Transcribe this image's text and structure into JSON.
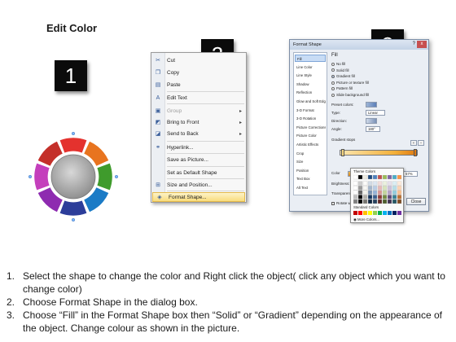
{
  "title": "Edit Color",
  "badges": [
    "1",
    "2",
    "3"
  ],
  "wheel": {
    "colors": [
      "#e4322e",
      "#e8741f",
      "#3f9b2c",
      "#1b7bc6",
      "#2c3d9a",
      "#8e2bb0",
      "#c43fbc",
      "#c4302a"
    ]
  },
  "context_menu": {
    "items": [
      {
        "label": "Cut",
        "icon": "cut-icon",
        "glyph": "✂",
        "disabled": false,
        "submenu": false,
        "highlighted": false
      },
      {
        "label": "Copy",
        "icon": "copy-icon",
        "glyph": "❐",
        "disabled": false,
        "submenu": false,
        "highlighted": false
      },
      {
        "label": "Paste",
        "icon": "paste-icon",
        "glyph": "▤",
        "disabled": false,
        "submenu": false,
        "highlighted": false
      },
      {
        "label": "Edit Text",
        "icon": "edit-text-icon",
        "glyph": "A",
        "disabled": false,
        "submenu": false,
        "highlighted": false
      },
      {
        "label": "Group",
        "icon": "group-icon",
        "glyph": "▣",
        "disabled": true,
        "submenu": true,
        "highlighted": false
      },
      {
        "label": "Bring to Front",
        "icon": "bring-to-front-icon",
        "glyph": "◩",
        "disabled": false,
        "submenu": true,
        "highlighted": false
      },
      {
        "label": "Send to Back",
        "icon": "send-to-back-icon",
        "glyph": "◪",
        "disabled": false,
        "submenu": true,
        "highlighted": false
      },
      {
        "label": "Hyperlink...",
        "icon": "hyperlink-icon",
        "glyph": "⚭",
        "disabled": false,
        "submenu": false,
        "highlighted": false
      },
      {
        "label": "Save as Picture...",
        "icon": "",
        "glyph": "",
        "disabled": false,
        "submenu": false,
        "highlighted": false
      },
      {
        "label": "Set as Default Shape",
        "icon": "",
        "glyph": "",
        "disabled": false,
        "submenu": false,
        "highlighted": false
      },
      {
        "label": "Size and Position...",
        "icon": "size-position-icon",
        "glyph": "⊞",
        "disabled": false,
        "submenu": false,
        "highlighted": false
      },
      {
        "label": "Format Shape...",
        "icon": "format-shape-icon",
        "glyph": "◈",
        "disabled": false,
        "submenu": false,
        "highlighted": true
      }
    ]
  },
  "dialog": {
    "title": "Format Shape",
    "help": "?",
    "close_x": "x",
    "nav": [
      "Fill",
      "Line Color",
      "Line Style",
      "Shadow",
      "Reflection",
      "Glow and Soft Edges",
      "3-D Format",
      "3-D Rotation",
      "Picture Corrections",
      "Picture Color",
      "Artistic Effects",
      "Crop",
      "Size",
      "Position",
      "Text Box",
      "Alt Text"
    ],
    "selected_nav": "Fill",
    "section": "Fill",
    "fill_options": [
      "No fill",
      "Solid fill",
      "Gradient fill",
      "Picture or texture fill",
      "Pattern fill",
      "Slide background fill"
    ],
    "selected_fill": "Gradient fill",
    "preset_colors_label": "Preset colors:",
    "type_label": "Type:",
    "type_value": "Linear",
    "direction_label": "Direction:",
    "angle_label": "Angle:",
    "angle_value": "180°",
    "gradient_stops_label": "Gradient stops",
    "color_label": "Color",
    "position_label": "Position:",
    "position_value": "57%",
    "brightness_label": "Brightness:",
    "transparency_label": "Transparency:",
    "rotate_label": "Rotate with shape",
    "close_button": "Close",
    "palette": {
      "theme_label": "Theme Colors",
      "standard_label": "Standard Colors",
      "more_label": "More Colors...",
      "theme_top": [
        "#ffffff",
        "#000000",
        "#eeece1",
        "#1f497d",
        "#4f81bd",
        "#c0504d",
        "#9bbb59",
        "#8064a2",
        "#4bacc6",
        "#f79646"
      ],
      "standard": [
        "#c00000",
        "#ff0000",
        "#ffc000",
        "#ffff00",
        "#92d050",
        "#00b050",
        "#00b0f0",
        "#0070c0",
        "#002060",
        "#7030a0"
      ]
    }
  },
  "instructions": [
    {
      "num": "1.",
      "text": "Select the shape to change the color and Right click the object( click any object which you want to change color)"
    },
    {
      "num": "2.",
      "text": "Choose Format Shape in the dialog box."
    },
    {
      "num": "3.",
      "text": "Choose “Fill” in the Format Shape box then “Solid” or “Gradient” depending on the appearance of the object. Change colour as shown in the picture."
    }
  ]
}
